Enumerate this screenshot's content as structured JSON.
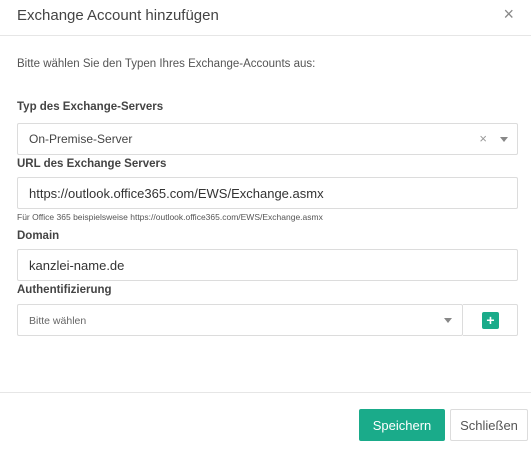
{
  "dialog": {
    "title": "Exchange Account hinzufügen",
    "close_glyph": "×"
  },
  "form": {
    "intro": "Bitte wählen Sie den Typen Ihres Exchange-Accounts aus:",
    "server_type": {
      "label": "Typ des Exchange-Servers",
      "selected": "On-Premise-Server",
      "clear_glyph": "×"
    },
    "server_url": {
      "label": "URL des Exchange Servers",
      "value": "https://outlook.office365.com/EWS/Exchange.asmx",
      "hint": "Für Office 365 beispielsweise https://outlook.office365.com/EWS/Exchange.asmx"
    },
    "domain": {
      "label": "Domain",
      "value": "kanzlei-name.de"
    },
    "authentication": {
      "label": "Authentifizierung",
      "placeholder": "Bitte wählen",
      "add_glyph": "+"
    }
  },
  "footer": {
    "save_label": "Speichern",
    "close_label": "Schließen"
  },
  "colors": {
    "accent": "#1aab8a",
    "border": "#dcdcdc"
  },
  "icons": {
    "close": "close-icon",
    "clear": "clear-icon",
    "dropdown": "chevron-down-icon",
    "add": "plus-icon"
  }
}
